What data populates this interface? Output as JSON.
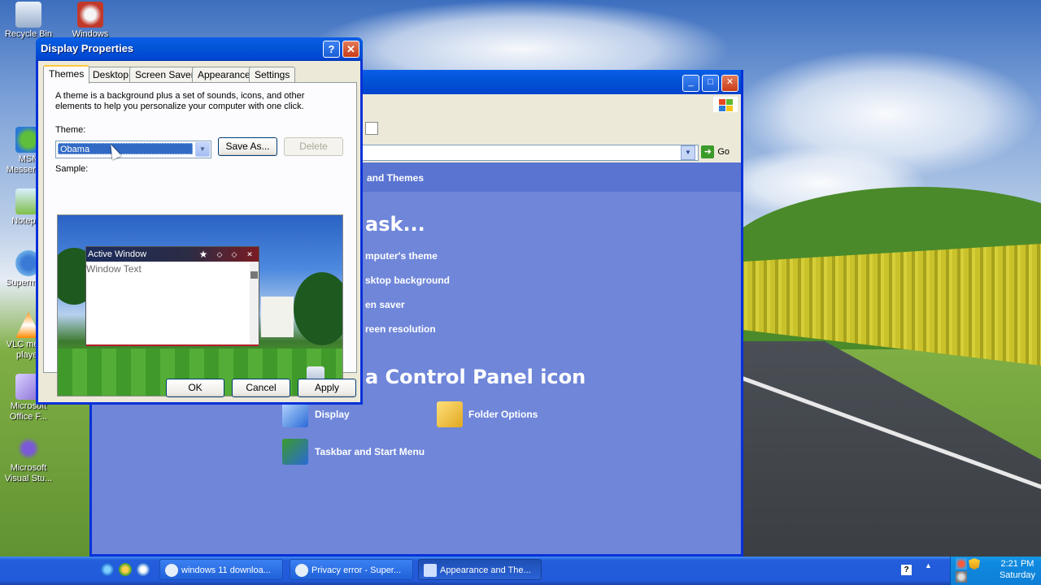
{
  "desktop": {
    "icons": [
      {
        "label": "Recycle Bin",
        "icon": "recycle-bin-icon"
      },
      {
        "label": "Windows",
        "icon": "movie-maker-icon"
      },
      {
        "label": "MSN Messenger",
        "icon": "msn-messenger-icon"
      },
      {
        "label": "Notepad",
        "icon": "notepad-icon"
      },
      {
        "label": "Supermium",
        "icon": "browser-icon"
      },
      {
        "label": "VLC media player",
        "icon": "vlc-icon"
      },
      {
        "label": "Microsoft Office F...",
        "icon": "office-icon"
      },
      {
        "label": "Microsoft Visual Stu...",
        "icon": "visual-studio-icon"
      }
    ]
  },
  "control_panel": {
    "header": "and Themes",
    "pick_task": "ask...",
    "tasks": [
      "mputer's theme",
      "sktop background",
      "en saver",
      "reen resolution"
    ],
    "pick_icon": "a Control Panel icon",
    "icons": [
      {
        "label": "Display",
        "icon": "display-icon"
      },
      {
        "label": "Folder Options",
        "icon": "folder-options-icon"
      },
      {
        "label": "Taskbar and Start Menu",
        "icon": "taskbar-icon"
      }
    ],
    "go_label": "Go",
    "buttons": {
      "minimize": "_",
      "maximize": "□",
      "close": "✕"
    }
  },
  "dialog": {
    "title": "Display Properties",
    "help": "?",
    "close": "✕",
    "tabs": [
      "Themes",
      "Desktop",
      "Screen Saver",
      "Appearance",
      "Settings"
    ],
    "active_tab": "Themes",
    "description": "A theme is a background plus a set of sounds, icons, and other elements to help you personalize your computer with one click.",
    "theme_label": "Theme:",
    "theme_value": "Obama",
    "save_as": "Save As...",
    "delete": "Delete",
    "sample_label": "Sample:",
    "sample": {
      "window_title": "Active Window",
      "window_text": "Window Text"
    },
    "ok": "OK",
    "cancel": "Cancel",
    "apply": "Apply"
  },
  "taskbar": {
    "tasks": [
      {
        "label": "windows 11 downloa...",
        "icon": "browser-icon",
        "active": false
      },
      {
        "label": "Privacy error - Super...",
        "icon": "browser-icon",
        "active": false
      },
      {
        "label": "Appearance and The...",
        "icon": "control-panel-icon",
        "active": true
      }
    ],
    "clock": {
      "time": "2:21 PM",
      "day": "Saturday"
    }
  }
}
